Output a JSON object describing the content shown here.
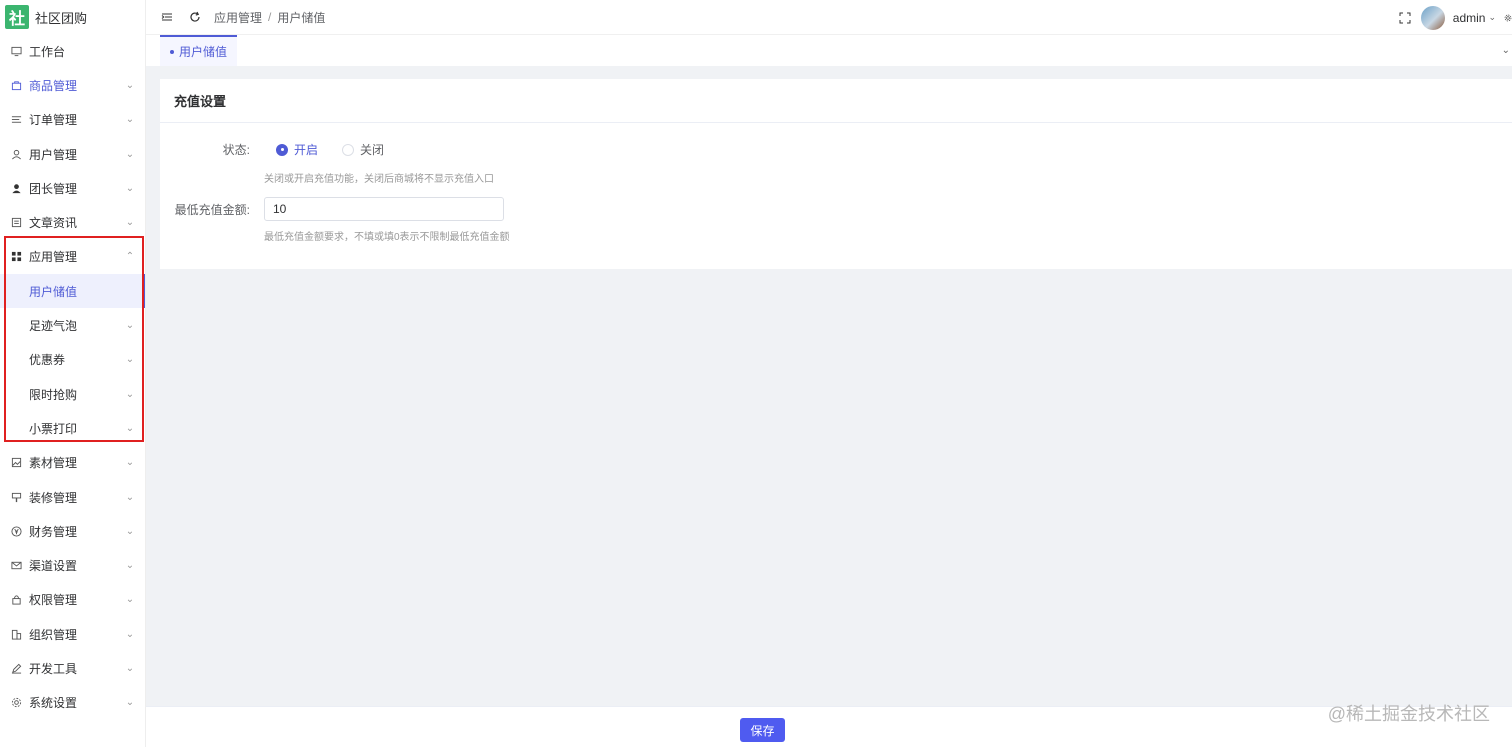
{
  "app": {
    "logo_char": "社",
    "name": "社区团购"
  },
  "sidebar": {
    "items": [
      {
        "label": "工作台",
        "icon": "monitor-icon",
        "expandable": false
      },
      {
        "label": "商品管理",
        "icon": "shopping-bag-icon",
        "expandable": true
      },
      {
        "label": "订单管理",
        "icon": "list-icon",
        "expandable": true
      },
      {
        "label": "用户管理",
        "icon": "user-icon",
        "expandable": true
      },
      {
        "label": "团长管理",
        "icon": "user-solid-icon",
        "expandable": true
      },
      {
        "label": "文章资讯",
        "icon": "article-icon",
        "expandable": true
      },
      {
        "label": "应用管理",
        "icon": "apps-grid-icon",
        "expandable": true
      },
      {
        "label": "素材管理",
        "icon": "image-icon",
        "expandable": true
      },
      {
        "label": "装修管理",
        "icon": "brush-icon",
        "expandable": true
      },
      {
        "label": "财务管理",
        "icon": "yen-icon",
        "expandable": true
      },
      {
        "label": "渠道设置",
        "icon": "mail-icon",
        "expandable": true
      },
      {
        "label": "权限管理",
        "icon": "lock-icon",
        "expandable": true
      },
      {
        "label": "组织管理",
        "icon": "building-icon",
        "expandable": true
      },
      {
        "label": "开发工具",
        "icon": "pen-icon",
        "expandable": true
      },
      {
        "label": "系统设置",
        "icon": "gear-icon",
        "expandable": true
      }
    ],
    "submenu": [
      {
        "label": "用户储值"
      },
      {
        "label": "足迹气泡"
      },
      {
        "label": "优惠券"
      },
      {
        "label": "限时抢购"
      },
      {
        "label": "小票打印"
      }
    ]
  },
  "header": {
    "breadcrumb": [
      "应用管理",
      "用户储值"
    ],
    "breadcrumb_sep": "/",
    "username": "admin"
  },
  "tabs": [
    {
      "label": "用户储值"
    }
  ],
  "card": {
    "title": "充值设置",
    "status_label": "状态:",
    "status_options": [
      "开启",
      "关闭"
    ],
    "status_selected": "开启",
    "status_hint": "关闭或开启充值功能，关闭后商城将不显示充值入口",
    "min_amount_label": "最低充值金额:",
    "min_amount_value": "10",
    "min_amount_hint": "最低充值金额要求，不填或填0表示不限制最低充值金额"
  },
  "footer": {
    "save_label": "保存"
  },
  "watermark": "@稀土掘金技术社区",
  "colors": {
    "accent": "#4f5bd5",
    "highlight_border": "#e02020",
    "logo_bg": "#3bb56f"
  }
}
